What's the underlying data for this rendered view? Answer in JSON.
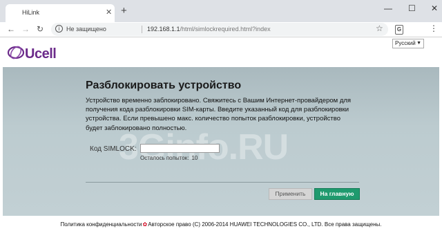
{
  "browser": {
    "tab_title": "HiLink",
    "tab_close": "✕",
    "new_tab": "+",
    "minimize": "—",
    "maximize": "☐",
    "close": "✕",
    "back": "←",
    "forward": "→",
    "reload": "↻",
    "security_label": "Не защищено",
    "url_host": "192.168.1.1",
    "url_path": "/html/simlockrequired.html?index",
    "star": "☆",
    "menu": "⋮"
  },
  "header": {
    "logo_text": "Ucell",
    "language": "Русский"
  },
  "main": {
    "title": "Разблокировать устройство",
    "description": "Устройство временно заблокировано. Свяжитесь с Вашим Интернет-провайдером для получения кода разблокировки SIM-карты. Введите указанный код для разблокировки устройства. Если превышено макс. количество попыток разблокировки, устройство будет заблокировано полностью.",
    "simlock_label": "Код SIMLOCK:",
    "simlock_value": "",
    "attempts_label": "Осталось попыток:",
    "attempts_value": "10",
    "apply_button": "Применить",
    "home_button": "На главную"
  },
  "watermark": "3Ginfo.RU",
  "footer": {
    "privacy": "Политика конфиденциальности",
    "copyright": "Авторское право (C) 2006-2014 HUAWEI TECHNOLOGIES CO., LTD. Все права защищены."
  },
  "colors": {
    "brand": "#6b2a8a",
    "primary_button": "#1f9a6e",
    "band": "#b3c3c8"
  }
}
